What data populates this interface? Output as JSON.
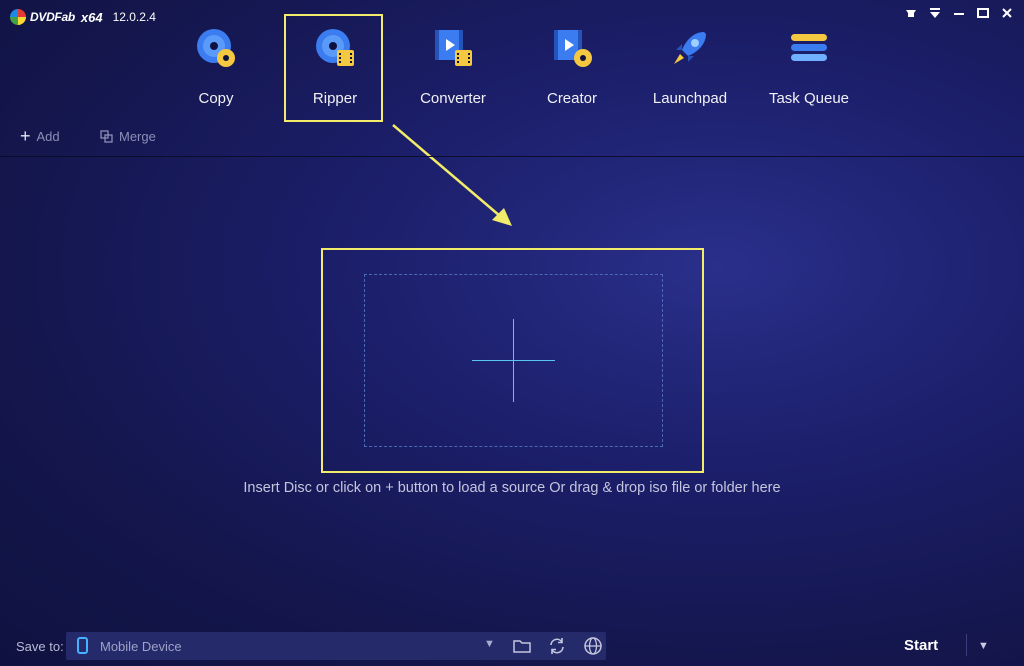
{
  "app": {
    "brand_name": "DVDFab",
    "arch": "x64",
    "version": "12.0.2.4",
    "window_controls": [
      "settings-icon",
      "dropdown-icon",
      "minimize-icon",
      "maximize-icon",
      "close-icon"
    ]
  },
  "modules": [
    {
      "label": "Copy",
      "icon": "disc-copy-icon"
    },
    {
      "label": "Ripper",
      "icon": "disc-ripper-icon",
      "selected": true
    },
    {
      "label": "Converter",
      "icon": "video-converter-icon"
    },
    {
      "label": "Creator",
      "icon": "video-creator-icon"
    },
    {
      "label": "Launchpad",
      "icon": "rocket-icon"
    },
    {
      "label": "Task Queue",
      "icon": "task-queue-icon"
    }
  ],
  "toolbar": {
    "add_label": "Add",
    "merge_label": "Merge"
  },
  "dropzone": {
    "hint": "Insert Disc or click on + button to load a source Or drag & drop iso file or folder here"
  },
  "bottom": {
    "save_to_label": "Save to:",
    "device": "Mobile Device",
    "start_label": "Start"
  },
  "colors": {
    "highlight": "#f2ec6a",
    "accent": "#59c6f0",
    "background": "#1c1f6b"
  }
}
